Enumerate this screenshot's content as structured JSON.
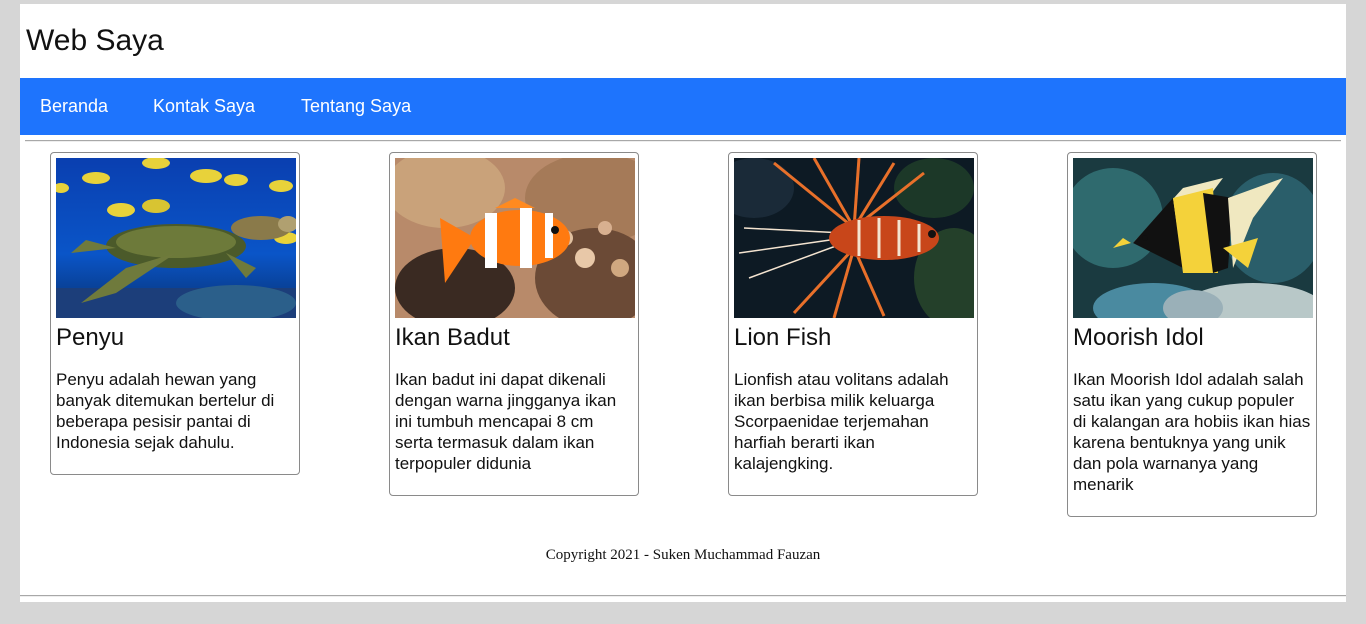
{
  "header": {
    "title": "Web Saya"
  },
  "nav": {
    "items": [
      {
        "label": "Beranda"
      },
      {
        "label": "Kontak Saya"
      },
      {
        "label": "Tentang Saya"
      }
    ]
  },
  "cards": [
    {
      "title": "Penyu",
      "image": "sea-turtle-image",
      "text": "Penyu adalah hewan yang banyak ditemukan bertelur di beberapa pesisir pantai di Indonesia sejak dahulu."
    },
    {
      "title": "Ikan Badut",
      "image": "clownfish-image",
      "text": "Ikan badut ini dapat dikenali dengan warna jingganya ikan ini tumbuh mencapai 8 cm serta termasuk dalam ikan terpopuler didunia"
    },
    {
      "title": "Lion Fish",
      "image": "lionfish-image",
      "text": "Lionfish atau volitans adalah ikan berbisa milik keluarga Scorpaenidae terjemahan harfiah berarti ikan kalajengking."
    },
    {
      "title": "Moorish Idol",
      "image": "moorish-idol-image",
      "text": "Ikan Moorish Idol adalah salah satu ikan yang cukup populer di kalangan ara hobiis ikan hias karena bentuknya yang unik dan pola warnanya yang menarik"
    }
  ],
  "footer": {
    "copyright": "Copyright 2021 - Suken Muchammad Fauzan"
  },
  "colors": {
    "navbar": "#1e74fd",
    "page_background": "#d6d6d6",
    "content_background": "#ffffff"
  }
}
